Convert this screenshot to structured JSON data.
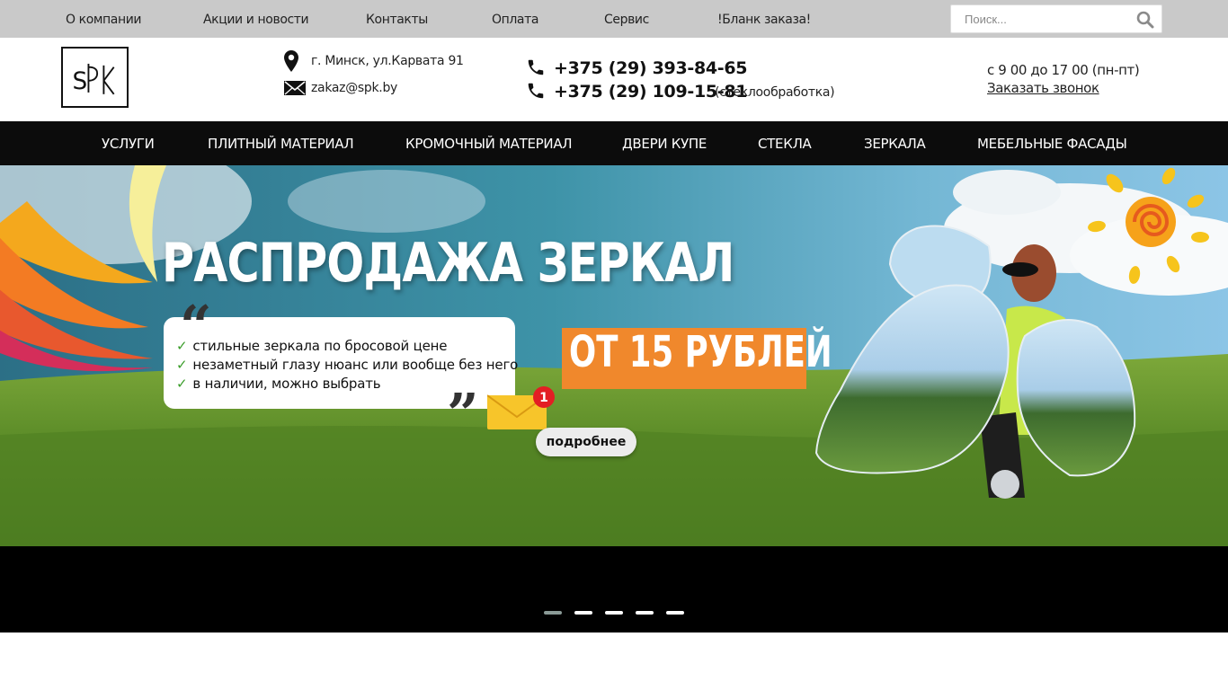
{
  "topnav": {
    "items": [
      {
        "label": "О компании"
      },
      {
        "label": "Акции и новости"
      },
      {
        "label": "Контакты"
      },
      {
        "label": "Оплата"
      },
      {
        "label": "Сервис"
      },
      {
        "label": "!Бланк заказа!"
      }
    ]
  },
  "search": {
    "placeholder": "Поиск...",
    "value": ""
  },
  "header": {
    "logo_text": "SPK",
    "address": "г. Минск, ул.Карвата 91",
    "email": "zakaz@spk.by",
    "phone1": "+375 (29) 393-84-65",
    "phone2": "+375 (29) 109-15-81",
    "phone2_note": "(стеклообработка)",
    "hours": "с 9 00 до 17 00 (пн-пт)",
    "callback": "Заказать звонок"
  },
  "mainnav": {
    "items": [
      {
        "label": "УСЛУГИ"
      },
      {
        "label": "ПЛИТНЫЙ МАТЕРИАЛ"
      },
      {
        "label": "КРОМОЧНЫЙ МАТЕРИАЛ"
      },
      {
        "label": "ДВЕРИ КУПЕ"
      },
      {
        "label": "СТЕКЛА"
      },
      {
        "label": "ЗЕРКАЛА"
      },
      {
        "label": "МЕБЕЛЬНЫЕ ФАСАДЫ"
      }
    ]
  },
  "banner": {
    "title": "РАСПРОДАЖА ЗЕРКАЛ",
    "bullets": [
      "стильные зеркала по бросовой цене",
      "незаметный глазу нюанс или вообще без него",
      "в наличии, можно выбрать"
    ],
    "price": "ОТ 15 РУБЛЕЙ",
    "badge_count": "1",
    "more_label": "подробнее"
  },
  "slider": {
    "slide_count": 5,
    "active_index": 0
  },
  "colors": {
    "topbar": "#c9c9c9",
    "nav": "#0c0c0c",
    "accent": "#f0882c",
    "check": "#3a9d2a"
  }
}
